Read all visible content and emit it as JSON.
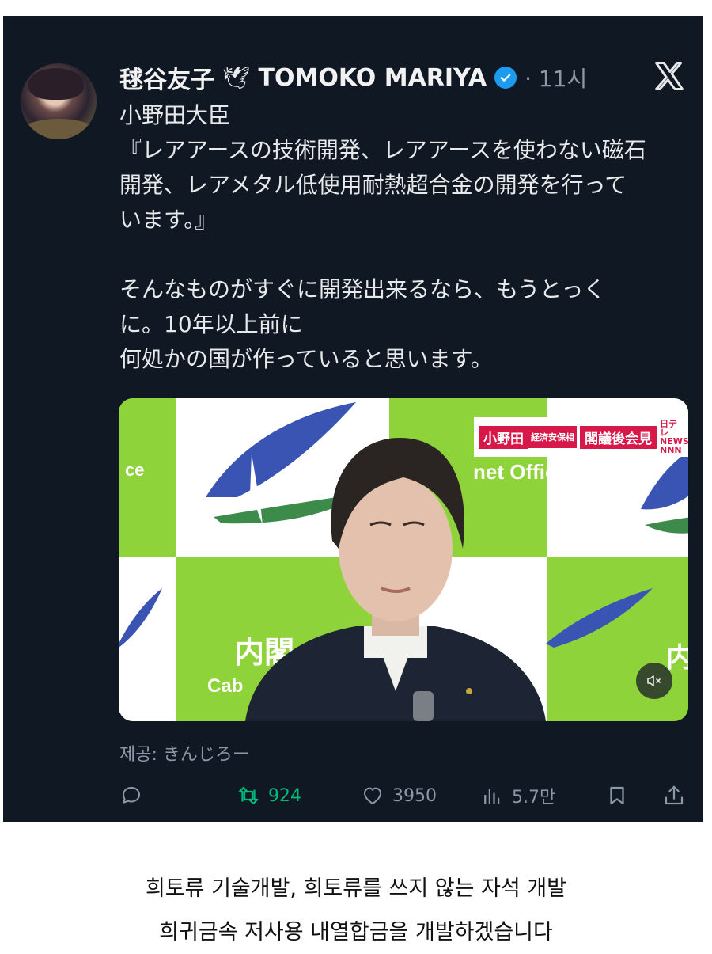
{
  "tweet": {
    "author_name": "毬谷友子",
    "author_emoji": "🕊",
    "author_alias": "TOMOKO MARIYA",
    "time": "· 11시",
    "lines": [
      "小野田大臣",
      "『レアアースの技術開発、レアアースを使わない磁石",
      "開発、レアメタル低使用耐熱超合金の開発を行って",
      "います。』",
      "",
      "そんなものがすぐに開発出来るなら、もうとっく",
      "に。10年以上前に",
      "何処かの国が作っていると思います。"
    ],
    "media": {
      "overlay_name": "小野田",
      "overlay_role": "経済安保相",
      "overlay_event": "閣議後会見",
      "overlay_channel": "日テレ NEWS NNN",
      "backdrop_text_1": "ce",
      "backdrop_text_2": "net Office",
      "backdrop_text_3": "内",
      "backdrop_text_4": "Cab",
      "backdrop_text_5": "内閣",
      "mute_icon": "speaker-mute-icon"
    },
    "provided_by": "제공: きんじろー",
    "actions": {
      "reply_icon": "reply-icon",
      "retweets": "924",
      "likes": "3950",
      "views": "5.7만",
      "bookmark_icon": "bookmark-icon",
      "share_icon": "share-icon"
    },
    "colors": {
      "background": "#0f1823",
      "accent": "#1d9bf0",
      "retweet": "#00ba7c"
    }
  },
  "caption": {
    "line1": "희토류 기술개발, 희토류를 쓰지 않는 자석 개발",
    "line2": "희귀금속 저사용 내열합금을 개발하겠습니다"
  }
}
